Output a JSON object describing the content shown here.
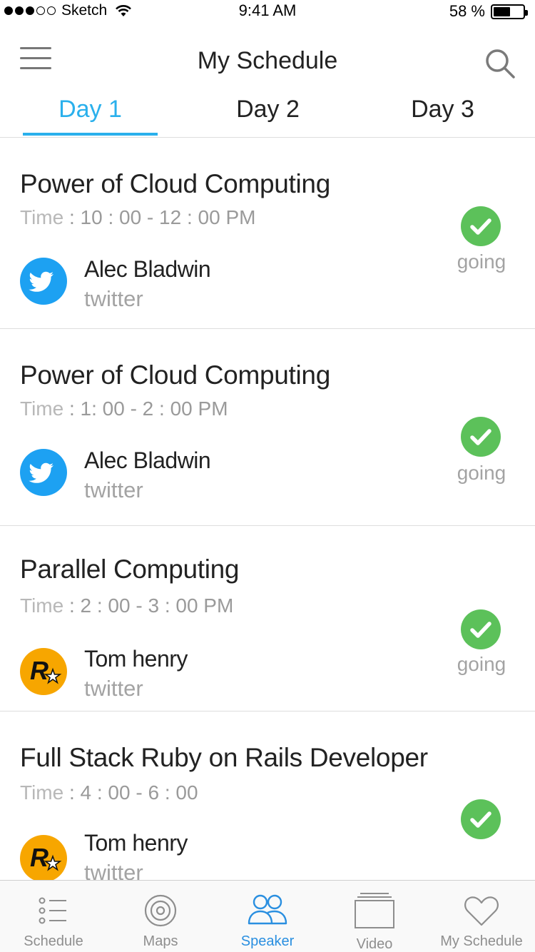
{
  "status_bar": {
    "carrier": "Sketch",
    "time": "9:41 AM",
    "battery_text": "58 %",
    "battery_level": 0.58
  },
  "nav": {
    "title": "My Schedule",
    "menu_icon": "hamburger-menu-icon",
    "search_icon": "search-icon"
  },
  "tabs": {
    "items": [
      {
        "label": "Day 1",
        "active": true
      },
      {
        "label": "Day 2",
        "active": false
      },
      {
        "label": "Day 3",
        "active": false
      }
    ]
  },
  "colors": {
    "accent": "#2ab0ec",
    "going": "#5cc15a",
    "twitter": "#1da1f2",
    "rockstar": "#f7a600",
    "tabbar_active": "#2a8fe0"
  },
  "sessions": [
    {
      "title": "Power of Cloud Computing",
      "time_label": "Time",
      "time_value": " : 10 : 00 - 12 : 00 PM",
      "speaker": "Alec Bladwin",
      "source": "twitter",
      "avatar": "twitter-bird-icon",
      "going_label": "going"
    },
    {
      "title": "Power of Cloud Computing",
      "time_label": "Time",
      "time_value": " : 1: 00 - 2 : 00 PM",
      "speaker": "Alec Bladwin",
      "source": "twitter",
      "avatar": "twitter-bird-icon",
      "going_label": "going"
    },
    {
      "title": "Parallel Computing",
      "time_label": "Time",
      "time_value": " : 2 : 00 - 3 : 00 PM",
      "speaker": "Tom henry",
      "source": "twitter",
      "avatar": "rockstar-logo-icon",
      "going_label": "going"
    },
    {
      "title": "Full Stack Ruby on Rails Developer",
      "time_label": "Time",
      "time_value": " : 4 : 00 - 6 : 00",
      "speaker": "Tom henry",
      "source": "twitter",
      "avatar": "rockstar-logo-icon",
      "going_label": ""
    }
  ],
  "tabbar": {
    "items": [
      {
        "label": "Schedule",
        "icon": "list-icon",
        "active": false
      },
      {
        "label": "Maps",
        "icon": "target-icon",
        "active": false
      },
      {
        "label": "Speaker",
        "icon": "people-icon",
        "active": true
      },
      {
        "label": "Video",
        "icon": "video-stack-icon",
        "active": false
      },
      {
        "label": "My Schedule",
        "icon": "heart-icon",
        "active": false
      }
    ]
  }
}
